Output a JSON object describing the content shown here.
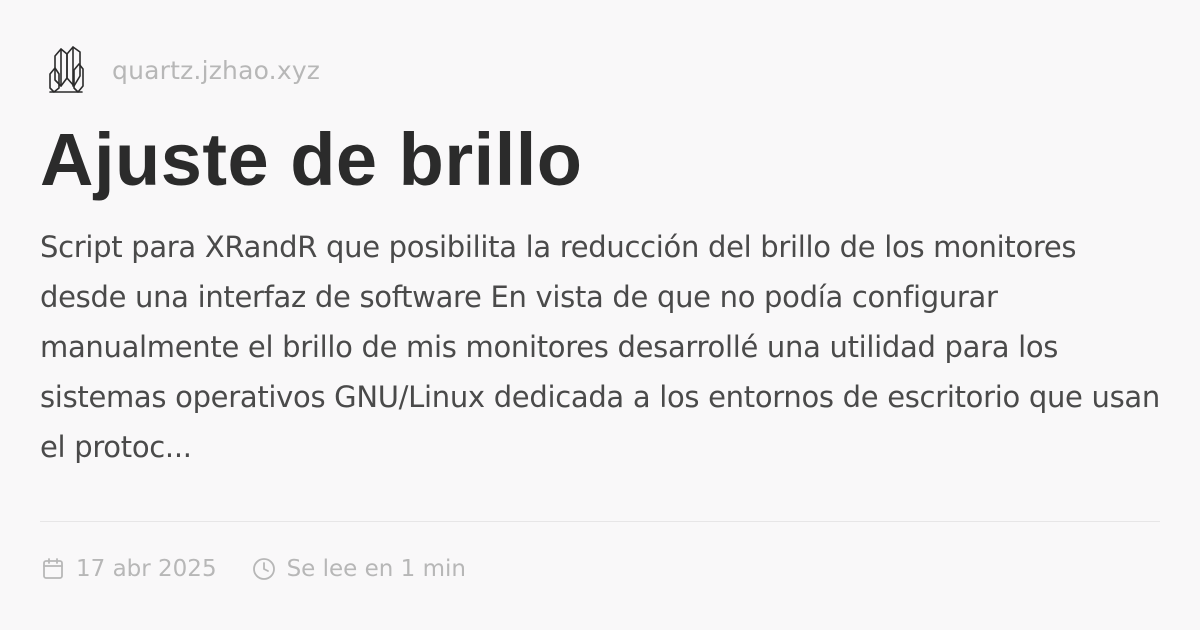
{
  "site": {
    "logo_icon": "quartz-crystal-icon",
    "name": "quartz.jzhao.xyz"
  },
  "page": {
    "title": "Ajuste de brillo",
    "description": "Script para XRandR que posibilita la reducción del brillo de los monitores desde una interfaz de software En vista de que no podía configurar manualmente el brillo de mis monitores desarrollé una utilidad para los sistemas operativos GNU/Linux dedicada a los entornos de escritorio que usan el protoc..."
  },
  "meta": {
    "date_icon": "calendar-icon",
    "date": "17 abr 2025",
    "reading_time_icon": "clock-icon",
    "reading_time": "Se lee en 1 min"
  },
  "colors": {
    "background": "#f9f8f9",
    "title": "#2b2b2b",
    "body_text": "#4a4a4a",
    "muted": "#b7b7b7",
    "divider": "#e7e6e7"
  }
}
